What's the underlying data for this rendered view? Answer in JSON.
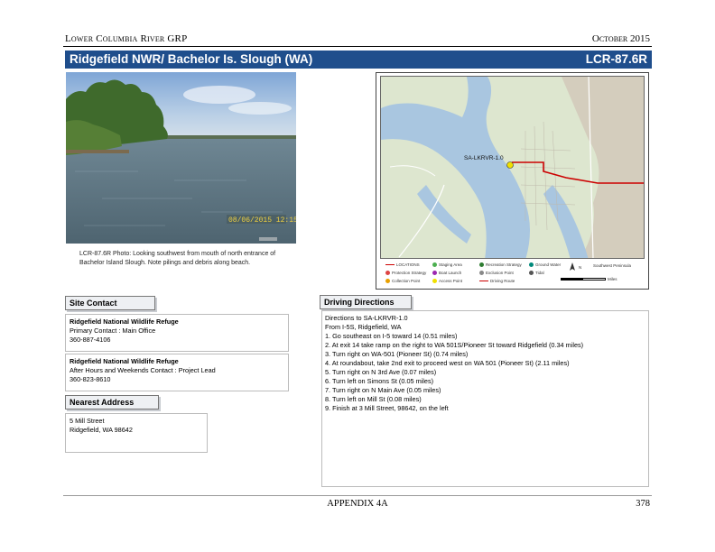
{
  "header": {
    "left": "Lower Columbia River GRP",
    "right": "October 2015"
  },
  "title_bar": {
    "site_name": "Ridgefield NWR/ Bachelor Is. Slough (WA)",
    "site_code": "LCR-87.6R"
  },
  "photo": {
    "caption": "LCR-87.6R Photo: Looking southwest from mouth of north entrance of Bachelor Island Slough. Note pilings and debris along beach."
  },
  "map": {
    "site_label": "SA-LKRVR-1.0",
    "legend": [
      {
        "label": "LOCATIONS",
        "color": "#cc0000"
      },
      {
        "label": "Protection Strategy",
        "color": "#d44"
      },
      {
        "label": "Collection Point",
        "color": "#e8a000"
      },
      {
        "label": "Staging Area",
        "color": "#4caf50"
      },
      {
        "label": "Boat Launch",
        "color": "#9c27b0"
      },
      {
        "label": "Access Point",
        "color": "#f0e000"
      },
      {
        "label": "Recreation Strategy",
        "color": "#2e7d32"
      },
      {
        "label": "Exclusion Point",
        "color": "#888"
      },
      {
        "label": "Driving Route",
        "color": "#cc0000"
      },
      {
        "label": "Ground Water",
        "color": "#00897b"
      },
      {
        "label": "Tidal",
        "color": "#555"
      }
    ],
    "north_label": "N",
    "scale_label": "Miles",
    "projection_label": "Southwest Peninsula"
  },
  "site_contact": {
    "label": "Site Contact",
    "contacts": [
      {
        "org": "Ridgefield National Wildlife Refuge",
        "role": "Primary Contact : Main Office",
        "phone": "360-887-4106"
      },
      {
        "org": "Ridgefield National Wildlife Refuge",
        "role": "After Hours and Weekends Contact : Project Lead",
        "phone": "360-823-8610"
      }
    ]
  },
  "nearest_address": {
    "label": "Nearest Address",
    "line1": "5 Mill Street",
    "line2": "Ridgefield, WA  98642"
  },
  "driving_directions": {
    "label": "Driving Directions",
    "lines": [
      "Directions to SA-LKRVR-1.0",
      "From I-5S, Ridgefield, WA",
      "1. Go southeast on I-5 toward 14 (0.51 miles)",
      "2. At exit 14 take ramp on the right to WA 501S/Pioneer St toward Ridgefield (0.34 miles)",
      "3. Turn right on WA-501 (Pioneer St) (0.74 miles)",
      "4. At roundabout, take 2nd exit to proceed west on WA 501 (Pioneer St) (2.11 miles)",
      "5. Turn right on N 3rd Ave (0.07 miles)",
      "6. Turn left on Simons St (0.05 miles)",
      "7. Turn right on N Main Ave (0.05 miles)",
      "8. Turn left on Mill St (0.08 miles)",
      "9. Finish at 3 Mill Street, 98642, on the left"
    ]
  },
  "footer": {
    "center": "APPENDIX 4A",
    "page": "378"
  }
}
